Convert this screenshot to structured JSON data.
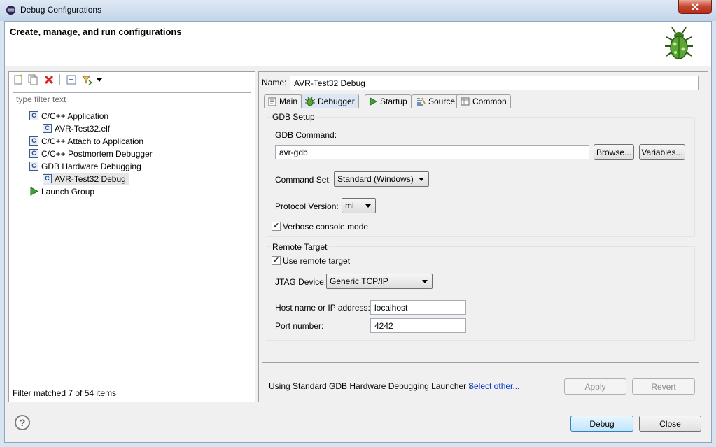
{
  "window": {
    "title": "Debug Configurations",
    "close_icon": "close-icon"
  },
  "header": {
    "title": "Create, manage, and run configurations",
    "icon": "bug-icon"
  },
  "left_toolbar": {
    "icons": [
      "new-config-icon",
      "duplicate-icon",
      "delete-icon",
      "collapse-all-icon",
      "filter-icon",
      "dropdown-icon"
    ]
  },
  "filter": {
    "placeholder": "type filter text"
  },
  "tree": [
    {
      "label": "C/C++ Application",
      "icon": "c-config-icon",
      "level": 1
    },
    {
      "label": "AVR-Test32.elf",
      "icon": "c-config-icon",
      "level": 2
    },
    {
      "label": "C/C++ Attach to Application",
      "icon": "c-config-icon",
      "level": 1
    },
    {
      "label": "C/C++ Postmortem Debugger",
      "icon": "c-config-icon",
      "level": 1
    },
    {
      "label": "GDB Hardware Debugging",
      "icon": "c-config-icon",
      "level": 1
    },
    {
      "label": "AVR-Test32 Debug",
      "icon": "c-config-icon",
      "level": 2,
      "selected": true
    },
    {
      "label": "Launch Group",
      "icon": "launch-group-icon",
      "level": 1
    }
  ],
  "filter_status": "Filter matched 7 of 54 items",
  "name": {
    "label": "Name:",
    "value": "AVR-Test32 Debug"
  },
  "tabs": [
    {
      "label": "Main",
      "icon": "main-tab-icon"
    },
    {
      "label": "Debugger",
      "icon": "debugger-tab-icon",
      "active": true
    },
    {
      "label": "Startup",
      "icon": "startup-tab-icon"
    },
    {
      "label": "Source",
      "icon": "source-tab-icon"
    },
    {
      "label": "Common",
      "icon": "common-tab-icon"
    }
  ],
  "gdb_setup": {
    "title": "GDB Setup",
    "command_label": "GDB Command:",
    "command_value": "avr-gdb",
    "browse_label": "Browse...",
    "variables_label": "Variables...",
    "command_set_label": "Command Set:",
    "command_set_value": "Standard (Windows)",
    "protocol_label": "Protocol Version:",
    "protocol_value": "mi",
    "verbose_label": "Verbose console mode",
    "verbose_checked": true
  },
  "remote_target": {
    "title": "Remote Target",
    "use_remote_label": "Use remote target",
    "use_remote_checked": true,
    "jtag_label": "JTAG Device:",
    "jtag_value": "Generic TCP/IP",
    "host_label": "Host name or IP address:",
    "host_value": "localhost",
    "port_label": "Port number:",
    "port_value": "4242"
  },
  "launcher": {
    "text": "Using Standard GDB Hardware Debugging Launcher - ",
    "link": "Select other..."
  },
  "apply_label": "Apply",
  "revert_label": "Revert",
  "debug_label": "Debug",
  "close_label": "Close",
  "help_icon": "help-icon"
}
